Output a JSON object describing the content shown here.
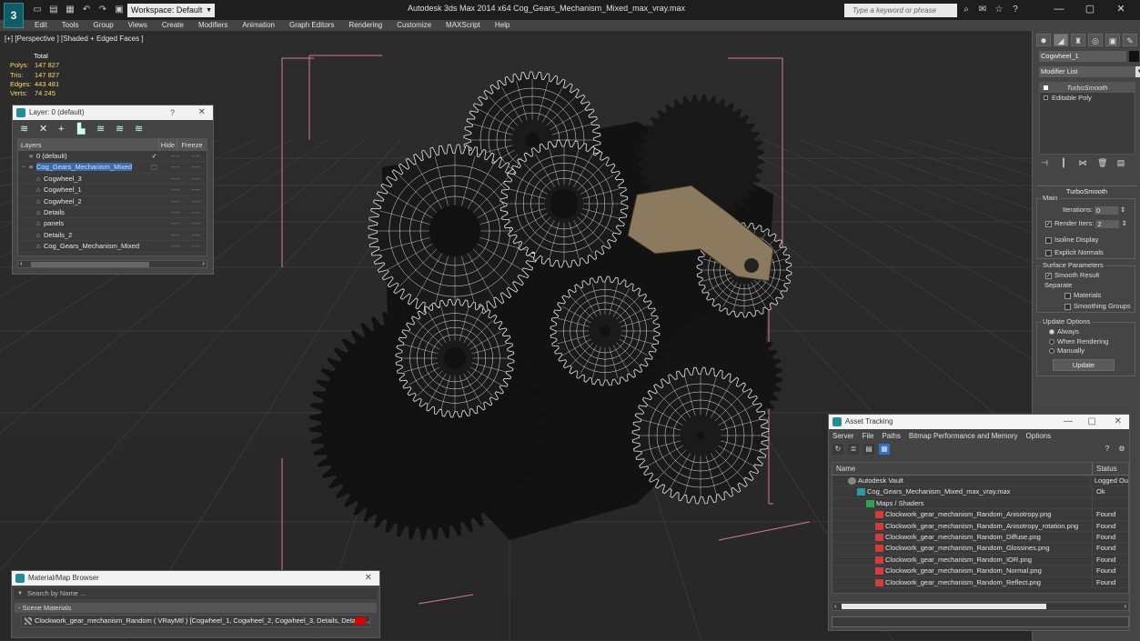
{
  "app": {
    "title": "Autodesk 3ds Max  2014 x64      Cog_Gears_Mechanism_Mixed_max_vray.max",
    "workspace": "Workspace: Default",
    "search_placeholder": "Type a keyword or phrase",
    "logo": "3"
  },
  "menu": [
    "Edit",
    "Tools",
    "Group",
    "Views",
    "Create",
    "Modifiers",
    "Animation",
    "Graph Editors",
    "Rendering",
    "Customize",
    "MAXScript",
    "Help"
  ],
  "viewport": {
    "label": "[+] [Perspective ] [Shaded + Edged Faces ]",
    "stats_header": "Total",
    "stats": [
      {
        "k": "Polys:",
        "v": "147 827"
      },
      {
        "k": "Tris:",
        "v": "147 827"
      },
      {
        "k": "Edges:",
        "v": "443 481"
      },
      {
        "k": "Verts:",
        "v": "74 245"
      }
    ]
  },
  "layer_window": {
    "title": "Layer: 0 (default)",
    "question": "?",
    "close": "✕",
    "columns": {
      "layers": "Layers",
      "hide": "Hide",
      "freeze": "Freeze"
    },
    "rows": [
      {
        "name": "0 (default)",
        "indent": 0,
        "check": "✓"
      },
      {
        "name": "Cog_Gears_Mechanism_Mixed",
        "indent": 0,
        "selected": true
      },
      {
        "name": "Cogwheel_3",
        "indent": 1
      },
      {
        "name": "Cogwheel_1",
        "indent": 1
      },
      {
        "name": "Cogwheel_2",
        "indent": 1
      },
      {
        "name": "Details",
        "indent": 1
      },
      {
        "name": "panels",
        "indent": 1
      },
      {
        "name": "Details_2",
        "indent": 1
      },
      {
        "name": "Cog_Gears_Mechanism_Mixed",
        "indent": 1
      }
    ],
    "dash": "----"
  },
  "command_panel": {
    "object_name": "Cogwheel_1",
    "modifier_list": "Modifier List",
    "stack": [
      "TurboSmooth",
      "Editable Poly"
    ],
    "rollout": "TurboSmooth",
    "main_label": "Main",
    "iterations_label": "Iterations:",
    "iterations_value": "0",
    "render_iters_label": "Render Iters:",
    "render_iters_value": "2",
    "isoline": "Isoline Display",
    "explicit_normals": "Explicit Normals",
    "surface_params": "Surface Parameters",
    "smooth_result": "Smooth Result",
    "separate": "Separate",
    "materials": "Materials",
    "smoothing_groups": "Smoothing Groups",
    "update_options": "Update Options",
    "always": "Always",
    "when_rendering": "When Rendering",
    "manually": "Manually",
    "update_button": "Update"
  },
  "asset_tracking": {
    "title": "Asset Tracking",
    "menu": [
      "Server",
      "File",
      "Paths",
      "Bitmap Performance and Memory",
      "Options"
    ],
    "columns": {
      "name": "Name",
      "status": "Status"
    },
    "rows": [
      {
        "name": "Autodesk Vault",
        "status": "Logged Ou",
        "indent": 1,
        "icon": "vault"
      },
      {
        "name": "Cog_Gears_Mechanism_Mixed_max_vray.max",
        "status": "Ok",
        "indent": 2,
        "icon": "max"
      },
      {
        "name": "Maps / Shaders",
        "status": "",
        "indent": 3,
        "icon": "map"
      },
      {
        "name": "Clockwork_gear_mechanism_Random_Anisotropy.png",
        "status": "Found",
        "indent": 4,
        "icon": "png"
      },
      {
        "name": "Clockwork_gear_mechanism_Random_Anisotropy_rotation.png",
        "status": "Found",
        "indent": 4,
        "icon": "png"
      },
      {
        "name": "Clockwork_gear_mechanism_Random_Diffuse.png",
        "status": "Found",
        "indent": 4,
        "icon": "png"
      },
      {
        "name": "Clockwork_gear_mechanism_Random_Glossines.png",
        "status": "Found",
        "indent": 4,
        "icon": "png"
      },
      {
        "name": "Clockwork_gear_mechanism_Random_IOR.png",
        "status": "Found",
        "indent": 4,
        "icon": "png"
      },
      {
        "name": "Clockwork_gear_mechanism_Random_Normal.png",
        "status": "Found",
        "indent": 4,
        "icon": "png"
      },
      {
        "name": "Clockwork_gear_mechanism_Random_Reflect.png",
        "status": "Found",
        "indent": 4,
        "icon": "png"
      }
    ]
  },
  "material_browser": {
    "title": "Material/Map Browser",
    "search_placeholder": "Search by Name ...",
    "section": "- Scene Materials",
    "item": "Clockwork_gear_mechanism_Random  ( VRayMtl ) [Cogwheel_1, Cogwheel_2, Cogwheel_3, Details, Details_..."
  }
}
